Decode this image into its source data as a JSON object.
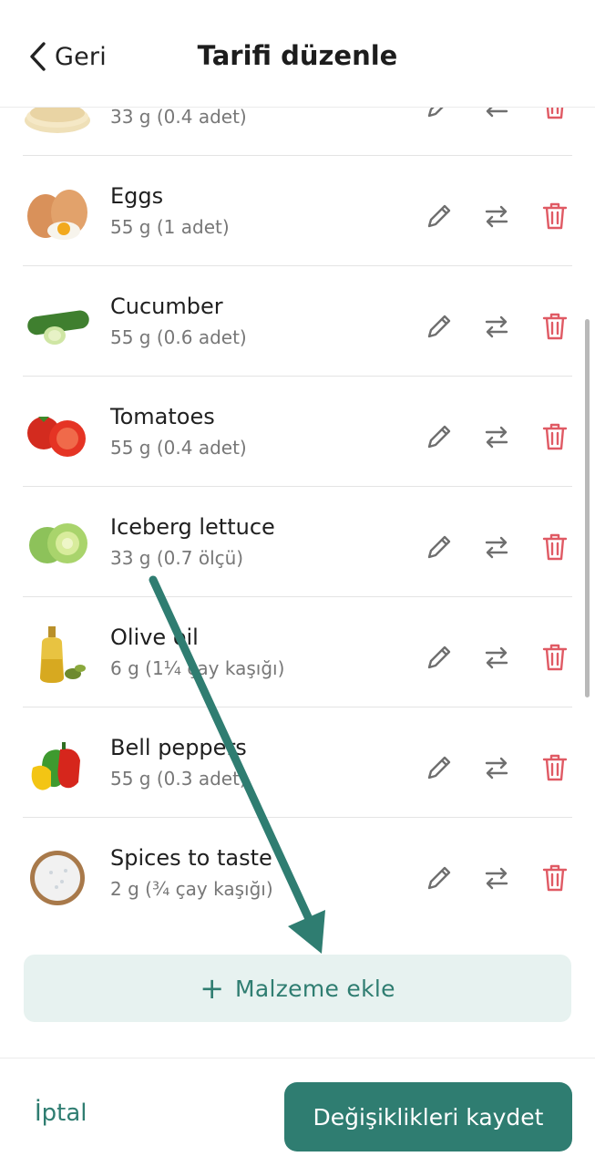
{
  "header": {
    "back_label": "Geri",
    "title": "Tarifi düzenle"
  },
  "ingredients": [
    {
      "name": "",
      "quantity": "33 g (0.4 adet)",
      "icon": "tortilla-icon"
    },
    {
      "name": "Eggs",
      "quantity": "55 g (1 adet)",
      "icon": "eggs-icon"
    },
    {
      "name": "Cucumber",
      "quantity": "55 g (0.6 adet)",
      "icon": "cucumber-icon"
    },
    {
      "name": "Tomatoes",
      "quantity": "55 g (0.4 adet)",
      "icon": "tomato-icon"
    },
    {
      "name": "Iceberg lettuce",
      "quantity": "33 g (0.7 ölçü)",
      "icon": "lettuce-icon"
    },
    {
      "name": "Olive oil",
      "quantity": "6 g (1¼ çay kaşığı)",
      "icon": "olive-oil-icon"
    },
    {
      "name": "Bell peppers",
      "quantity": "55 g (0.3 adet)",
      "icon": "bell-pepper-icon"
    },
    {
      "name": "Spices to taste",
      "quantity": "2 g (¾ çay kaşığı)",
      "icon": "salt-icon"
    }
  ],
  "add_button": {
    "label": "Malzeme ekle"
  },
  "footer": {
    "cancel_label": "İptal",
    "save_label": "Değişiklikleri kaydet"
  },
  "colors": {
    "accent": "#2f7d71",
    "accent_light": "#e7f2f0",
    "delete": "#e05a64",
    "icon_gray": "#6f6f6f"
  }
}
